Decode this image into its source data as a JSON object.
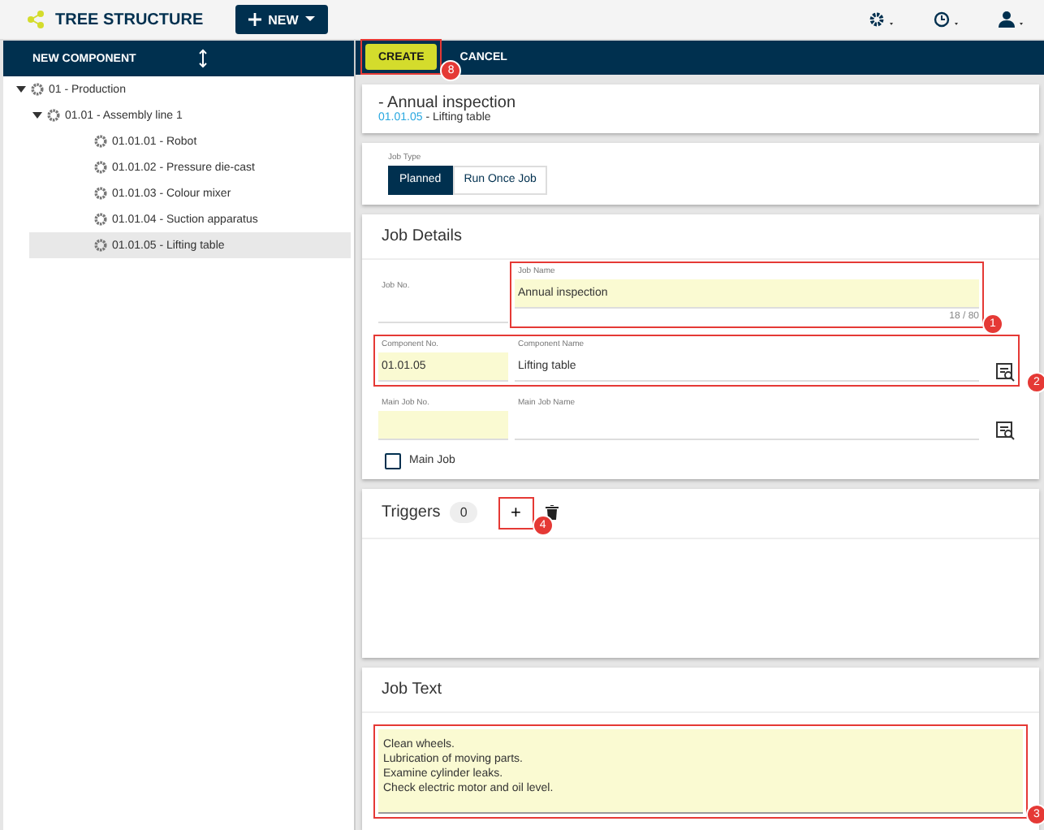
{
  "app": {
    "title": "TREE STRUCTURE",
    "new_button": "NEW"
  },
  "sidebar": {
    "new_component": "NEW COMPONENT",
    "tree": [
      {
        "label": "01 - Production",
        "expanded": true,
        "selected": false,
        "children": [
          {
            "label": "01.01 - Assembly line 1",
            "expanded": true,
            "selected": false,
            "children": [
              {
                "label": "01.01.01 - Robot",
                "selected": false
              },
              {
                "label": "01.01.02 - Pressure die-cast",
                "selected": false
              },
              {
                "label": "01.01.03 - Colour mixer",
                "selected": false
              },
              {
                "label": "01.01.04 - Suction apparatus",
                "selected": false
              },
              {
                "label": "01.01.05 - Lifting table",
                "selected": true
              }
            ]
          }
        ]
      }
    ]
  },
  "actions": [
    {
      "label": "CREATE",
      "kind": "primary",
      "callout": "8"
    },
    {
      "label": "CANCEL",
      "kind": "plain"
    }
  ],
  "header": {
    "title": "- Annual inspection",
    "component_no": "01.01.05",
    "component_name": "- Lifting table"
  },
  "job_type": {
    "label": "Job Type",
    "options": [
      {
        "label": "Planned",
        "selected": true
      },
      {
        "label": "Run Once Job",
        "selected": false
      }
    ]
  },
  "job_details": {
    "title": "Job Details",
    "rows": [
      {
        "lookup": false,
        "fields": [
          {
            "label": "Job No.",
            "required": false
          },
          {
            "label": "Job Name",
            "value": "Annual inspection",
            "required": true,
            "counter": "18 / 80",
            "callout": "1"
          }
        ]
      },
      {
        "lookup": true,
        "callout": "2",
        "fields": [
          {
            "label": "Component No.",
            "value": "01.01.05",
            "required": true
          },
          {
            "label": "Component Name",
            "value": "Lifting table",
            "required": false
          }
        ]
      },
      {
        "lookup": true,
        "fields": [
          {
            "label": "Main Job No.",
            "required": true
          },
          {
            "label": "Main Job Name",
            "required": false
          }
        ]
      }
    ],
    "checkbox": {
      "label": "Main Job",
      "checked": false
    }
  },
  "triggers": {
    "title": "Triggers",
    "count": "0",
    "add": "+",
    "add_callout": "4"
  },
  "job_text": {
    "title": "Job Text",
    "callout": "3",
    "lines": [
      "Clean wheels.",
      "Lubrication of moving parts.",
      "Examine cylinder leaks.",
      "Check electric motor and oil level."
    ]
  }
}
